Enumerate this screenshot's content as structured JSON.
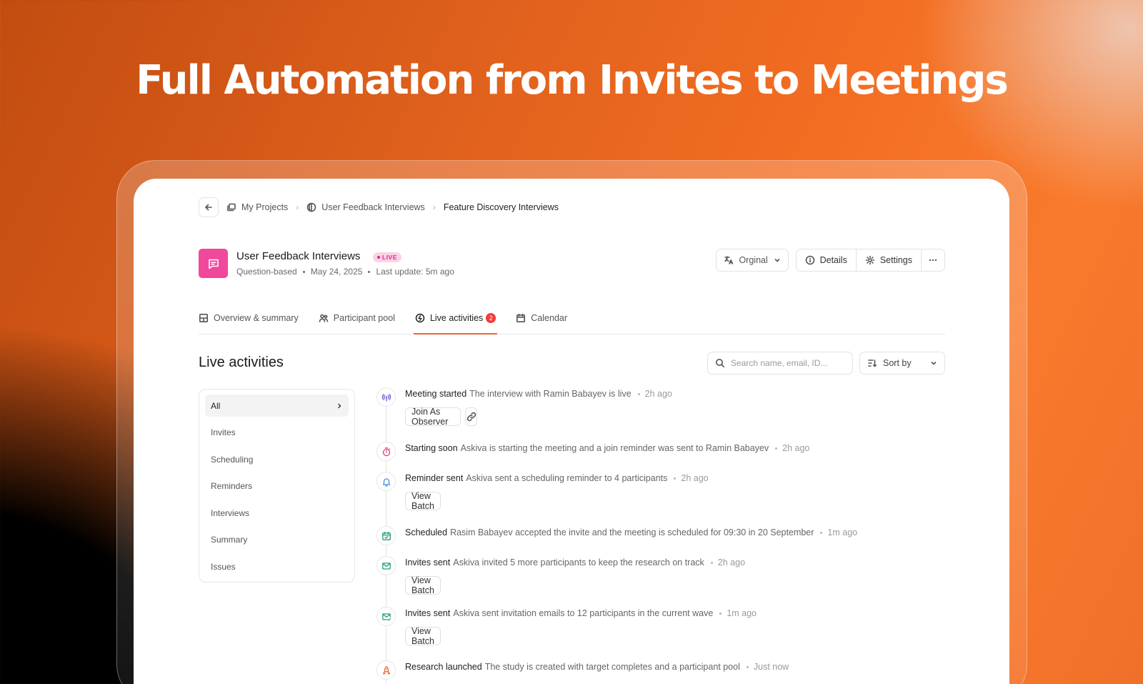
{
  "hero": {
    "title": "Full Automation from Invites to Meetings"
  },
  "breadcrumb": {
    "items": [
      {
        "label": "My Projects"
      },
      {
        "label": "User Feedback Interviews"
      },
      {
        "label": "Feature Discovery Interviews"
      }
    ]
  },
  "project": {
    "name": "User Feedback Interviews",
    "status": "LIVE",
    "type": "Question-based",
    "date": "May 24, 2025",
    "last_update": "Last update: 5m ago",
    "accent_color": "#f0489a"
  },
  "header_actions": {
    "language": "Orginal",
    "details": "Details",
    "settings": "Settings"
  },
  "tabs": [
    {
      "label": "Overview & summary",
      "icon": "grid-icon"
    },
    {
      "label": "Participant pool",
      "icon": "users-icon"
    },
    {
      "label": "Live activities",
      "icon": "activity-icon",
      "badge": "2",
      "active": true
    },
    {
      "label": "Calendar",
      "icon": "calendar-icon"
    }
  ],
  "section": {
    "title": "Live activities",
    "search_placeholder": "Search name, email, ID...",
    "sort_label": "Sort by"
  },
  "filters": [
    {
      "label": "All",
      "active": true
    },
    {
      "label": "Invites"
    },
    {
      "label": "Scheduling"
    },
    {
      "label": "Reminders"
    },
    {
      "label": "Interviews"
    },
    {
      "label": "Summary"
    },
    {
      "label": "Issues"
    }
  ],
  "activities": [
    {
      "icon": "broadcast-icon",
      "color": "#7a5cd6",
      "title": "Meeting started",
      "text": "The interview with Ramin Babayev is live",
      "time": "2h ago",
      "action": "Join As Observer",
      "link": true
    },
    {
      "icon": "stopwatch-icon",
      "color": "#e2416f",
      "title": "Starting soon",
      "text": "Askiva is starting the meeting and a join reminder was sent to Ramin Babayev",
      "time": "2h ago"
    },
    {
      "icon": "bell-icon",
      "color": "#4a90e2",
      "title": "Reminder sent",
      "text": "Askiva sent a scheduling reminder to 4 participants",
      "time": "2h ago",
      "action": "View Batch"
    },
    {
      "icon": "calendar-check-icon",
      "color": "#22a06b",
      "title": "Scheduled",
      "text": "Rasim Babayev accepted the invite and the meeting is scheduled for 09:30 in 20 September",
      "time": "1m ago"
    },
    {
      "icon": "mail-icon",
      "color": "#22a06b",
      "title": "Invites sent",
      "text": "Askiva invited 5 more participants to keep the research on track",
      "time": "2h ago",
      "action": "View Batch"
    },
    {
      "icon": "mail-check-icon",
      "color": "#22a06b",
      "title": "Invites sent",
      "text": "Askiva sent invitation emails to 12 participants in the current wave",
      "time": "1m ago",
      "action": "View Batch"
    },
    {
      "icon": "rocket-icon",
      "color": "#f06a2a",
      "title": "Research launched",
      "text": "The study is created with target completes and a participant pool",
      "time": "Just now"
    }
  ]
}
